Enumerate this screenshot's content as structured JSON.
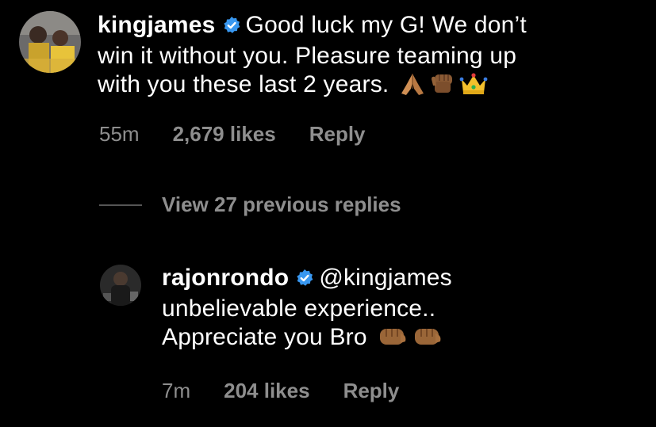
{
  "comment1": {
    "username": "kingjames",
    "line1": "Good luck my G! We don’t",
    "line2": "win it without you. Pleasure teaming up",
    "line3": "with you these last 2 years.",
    "emojis": [
      "folded-hands",
      "raised-fist",
      "crown"
    ],
    "time": "55m",
    "likes": "2,679 likes",
    "reply_label": "Reply"
  },
  "view_replies": "View 27 previous replies",
  "comment2": {
    "username": "rajonrondo",
    "mention": "@kingjames",
    "line2": "unbelievable experience..",
    "line3": "Appreciate you Bro",
    "emojis": [
      "oncoming-fist",
      "oncoming-fist"
    ],
    "time": "7m",
    "likes": "204 likes",
    "reply_label": "Reply"
  },
  "colors": {
    "background": "#000000",
    "text": "#ffffff",
    "muted": "#8e8e8e",
    "verified": "#3897f0"
  }
}
